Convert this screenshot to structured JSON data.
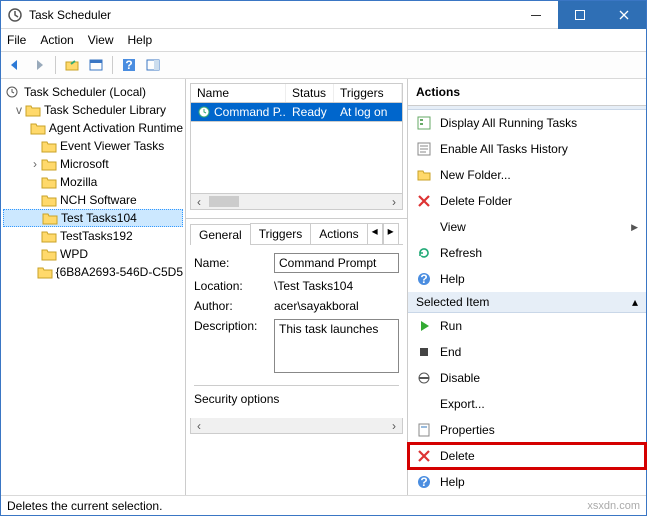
{
  "window": {
    "title": "Task Scheduler"
  },
  "menubar": [
    "File",
    "Action",
    "View",
    "Help"
  ],
  "tree": {
    "root": "Task Scheduler (Local)",
    "lib": "Task Scheduler Library",
    "items": [
      "Agent Activation Runtime",
      "Event Viewer Tasks",
      "Microsoft",
      "Mozilla",
      "NCH Software",
      "Test Tasks104",
      "TestTasks192",
      "WPD",
      "{6B8A2693-546D-C5D5"
    ],
    "selectedIndex": 5
  },
  "list": {
    "headers": [
      "Name",
      "Status",
      "Triggers"
    ],
    "row": {
      "name": "Command P...",
      "status": "Ready",
      "trigger": "At log on"
    }
  },
  "detail": {
    "tabs": [
      "General",
      "Triggers",
      "Actions"
    ],
    "name_label": "Name:",
    "name_value": "Command Prompt",
    "loc_label": "Location:",
    "loc_value": "\\Test Tasks104",
    "author_label": "Author:",
    "author_value": "acer\\sayakboral",
    "desc_label": "Description:",
    "desc_value": "This task launches",
    "sec_label": "Security options"
  },
  "actions": {
    "header": "Actions",
    "sec1": "",
    "items1": [
      {
        "icon": "tasks",
        "label": "Display All Running Tasks"
      },
      {
        "icon": "hist",
        "label": "Enable All Tasks History"
      },
      {
        "icon": "folder",
        "label": "New Folder..."
      },
      {
        "icon": "delfolder",
        "label": "Delete Folder"
      },
      {
        "icon": "view",
        "label": "View",
        "sub": true
      },
      {
        "icon": "refresh",
        "label": "Refresh"
      },
      {
        "icon": "help",
        "label": "Help"
      }
    ],
    "sec2": "Selected Item",
    "items2": [
      {
        "icon": "run",
        "label": "Run"
      },
      {
        "icon": "end",
        "label": "End"
      },
      {
        "icon": "disable",
        "label": "Disable"
      },
      {
        "icon": "export",
        "label": "Export..."
      },
      {
        "icon": "props",
        "label": "Properties"
      },
      {
        "icon": "delete",
        "label": "Delete",
        "hl": true
      },
      {
        "icon": "help",
        "label": "Help"
      }
    ]
  },
  "status": "Deletes the current selection.",
  "watermark": "xsxdn.com"
}
